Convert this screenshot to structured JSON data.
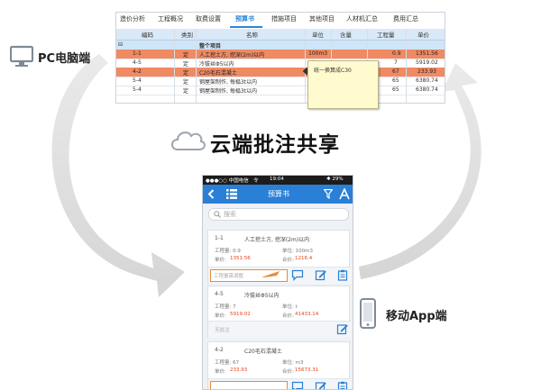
{
  "desktop": {
    "tabs": [
      "造价分析",
      "工程概况",
      "取费设置",
      "预算书",
      "措施项目",
      "其他项目",
      "人材机汇总",
      "费用汇总"
    ],
    "active_tab": "预算书",
    "columns": [
      "编码",
      "类别",
      "名称",
      "单位",
      "含量",
      "工程量",
      "单价"
    ],
    "section_row": {
      "toggle": "⊟",
      "name": "整个项目"
    },
    "rows": [
      {
        "code": "1-1",
        "type": "定",
        "name": "人工挖土方, 挖深(2m)以内",
        "unit": "100m3",
        "qty": "0.9",
        "price": "1351.56",
        "style": "orange"
      },
      {
        "code": "4-5",
        "type": "定",
        "name": "冷拔丝Φ5以内",
        "unit": "t",
        "qty": "7",
        "price": "5919.02",
        "style": "plain"
      },
      {
        "code": "4-2",
        "type": "定",
        "name": "C20毛石混凝土",
        "unit": "",
        "qty": "67",
        "price": "233.93",
        "style": "orange"
      },
      {
        "code": "5-4",
        "type": "定",
        "name": "钢屋架制作, 每榀3t以内",
        "unit": "",
        "qty": "65",
        "price": "6380.74",
        "style": "plain"
      },
      {
        "code": "5-4",
        "type": "定",
        "name": "钢屋架制作, 每榀3t以内",
        "unit": "",
        "qty": "65",
        "price": "6380.74",
        "style": "plain"
      }
    ],
    "note_text": "统一换算成C30"
  },
  "labels": {
    "pc": "PC电脑端",
    "cloud": "云端批注共享",
    "mobile": "移动App端"
  },
  "phone": {
    "status": {
      "carrier": "●●●○○ 中国电信",
      "wifi": "令",
      "time": "19:04",
      "battery": "✱ 29%"
    },
    "title": "预算书",
    "search_placeholder": "搜索",
    "cards": [
      {
        "code": "1-1",
        "name": "人工挖土方, 挖深(2m)以内",
        "qty_label": "工程量: 0.9",
        "unit_label": "单位: 100m3",
        "price_label": "单价:",
        "price": "1351.56",
        "total_label": "合价:",
        "total": "1216.4",
        "note_placeholder": "工程量需调整"
      },
      {
        "code": "4-5",
        "name": "冷拔丝Φ5以内",
        "qty_label": "工程量: 7",
        "unit_label": "单位: t",
        "price_label": "单价:",
        "price": "5919.02",
        "total_label": "合价:",
        "total": "41433.14",
        "note_placeholder": "无批注"
      },
      {
        "code": "4-2",
        "name": "C20毛石混凝土",
        "qty_label": "工程量: 67",
        "unit_label": "单位: m3",
        "price_label": "单价:",
        "price": "233.93",
        "total_label": "合价:",
        "total": "15673.31",
        "note_placeholder": ""
      }
    ]
  },
  "colors": {
    "accent": "#2a7fd6",
    "highlight": "#ef8a63",
    "price": "#e0451c"
  }
}
